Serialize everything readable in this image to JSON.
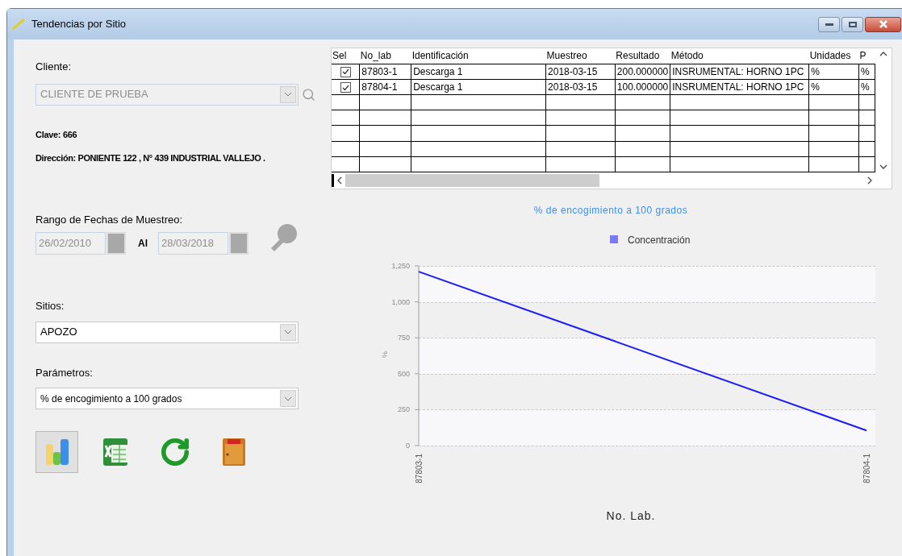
{
  "window": {
    "title": "Tendencias por Sitio"
  },
  "form": {
    "cliente": {
      "label": "Cliente:",
      "value": "CLIENTE DE PRUEBA",
      "disabled": true
    },
    "clave": "Clave: 666",
    "direccion": "Dirección: PONIENTE 122 , N° 439 INDUSTRIAL VALLEJO .",
    "rango": {
      "label": "Rango de Fechas de Muestreo:",
      "from": "26/02/2010",
      "separator": "Al",
      "to": "28/03/2018"
    },
    "sitios": {
      "label": "Sitios:",
      "value": "APOZO"
    },
    "parametros": {
      "label": "Parámetros:",
      "value": "% de encogimiento a  100 grados"
    },
    "toolbar": [
      {
        "kind": "chart",
        "selected": true
      },
      {
        "kind": "excel",
        "selected": false
      },
      {
        "kind": "refresh",
        "selected": false
      },
      {
        "kind": "exit",
        "selected": false
      }
    ]
  },
  "table": {
    "columns": [
      "Sel",
      "No_lab",
      "Identificación",
      "Muestreo",
      "Resultado",
      "Método",
      "Unidades",
      "P"
    ],
    "rows": [
      {
        "checked": true,
        "cells": [
          "",
          "87803-1",
          "Descarga 1",
          "2018-03-15",
          "200.000000",
          "INSRUMENTAL: HORNO 1PC",
          "%",
          "%"
        ]
      },
      {
        "checked": true,
        "cells": [
          "",
          "87804-1",
          "Descarga 1",
          "2018-03-15",
          "100.000000",
          "INSRUMENTAL: HORNO 1PC",
          "%",
          "%"
        ]
      }
    ]
  },
  "chart": {
    "chart_data": {
      "type": "line",
      "title": "% de encogimiento a  100 grados",
      "xlabel": "No. Lab.",
      "ylabel": "%",
      "categories": [
        "87803-1",
        "87804-1"
      ],
      "series": [
        {
          "name": "Concentración",
          "color": "#1a1aff",
          "values": [
            1210,
            105
          ]
        }
      ],
      "ylim": [
        0,
        1250
      ],
      "yticks": [
        {
          "value": 0,
          "label": "0"
        },
        {
          "value": 250,
          "label": "250"
        },
        {
          "value": 500,
          "label": "500"
        },
        {
          "value": 750,
          "label": "750"
        },
        {
          "value": 1000,
          "label": "1,000"
        },
        {
          "value": 1250,
          "label": "1,250"
        }
      ]
    }
  }
}
